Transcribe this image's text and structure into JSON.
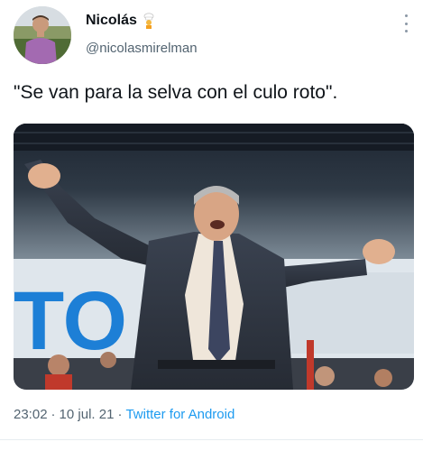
{
  "author": {
    "name": "Nicolás",
    "handle": "@nicolasmirelman",
    "badge_icon": "chef-emoji-icon"
  },
  "tweet": {
    "text": "\"Se van para la selva con el culo roto\"."
  },
  "meta": {
    "time": "23:02",
    "separator1": "·",
    "date": "10 jul. 21",
    "separator2": "·",
    "source": "Twitter for Android"
  },
  "colors": {
    "link": "#1d9bf0",
    "secondary_text": "#536471",
    "primary_text": "#0f1419"
  }
}
